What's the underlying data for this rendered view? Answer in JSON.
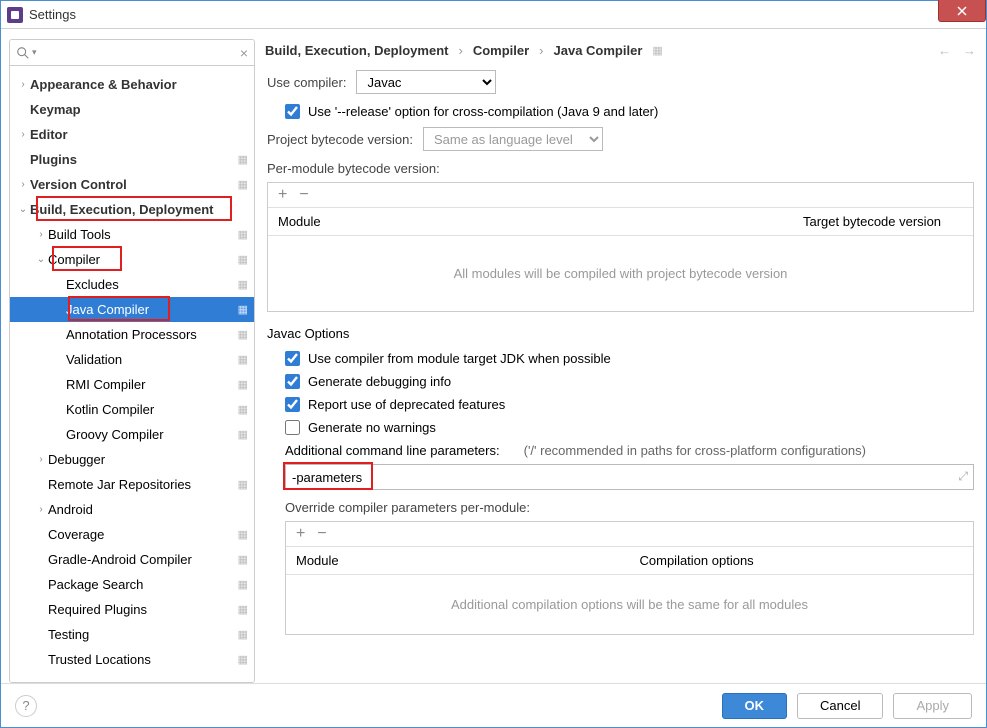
{
  "window": {
    "title": "Settings"
  },
  "search": {
    "placeholder": ""
  },
  "sidebar": {
    "items": [
      {
        "label": "Appearance & Behavior",
        "bold": true,
        "chev": "›",
        "indent": 0,
        "gear": false
      },
      {
        "label": "Keymap",
        "bold": true,
        "chev": "",
        "indent": 0,
        "gear": false
      },
      {
        "label": "Editor",
        "bold": true,
        "chev": "›",
        "indent": 0,
        "gear": false
      },
      {
        "label": "Plugins",
        "bold": true,
        "chev": "",
        "indent": 0,
        "gear": true
      },
      {
        "label": "Version Control",
        "bold": true,
        "chev": "›",
        "indent": 0,
        "gear": true
      },
      {
        "label": "Build, Execution, Deployment",
        "bold": true,
        "chev": "⌄",
        "indent": 0,
        "gear": false,
        "red": true,
        "redLeft": 30,
        "redWidth": 196
      },
      {
        "label": "Build Tools",
        "bold": false,
        "chev": "›",
        "indent": 1,
        "gear": true
      },
      {
        "label": "Compiler",
        "bold": false,
        "chev": "⌄",
        "indent": 1,
        "gear": true,
        "red": true,
        "redLeft": 46,
        "redWidth": 70
      },
      {
        "label": "Excludes",
        "bold": false,
        "chev": "",
        "indent": 2,
        "gear": true
      },
      {
        "label": "Java Compiler",
        "bold": false,
        "chev": "",
        "indent": 2,
        "gear": true,
        "selected": true,
        "red": true,
        "redLeft": 62,
        "redWidth": 102
      },
      {
        "label": "Annotation Processors",
        "bold": false,
        "chev": "",
        "indent": 2,
        "gear": true
      },
      {
        "label": "Validation",
        "bold": false,
        "chev": "",
        "indent": 2,
        "gear": true
      },
      {
        "label": "RMI Compiler",
        "bold": false,
        "chev": "",
        "indent": 2,
        "gear": true
      },
      {
        "label": "Kotlin Compiler",
        "bold": false,
        "chev": "",
        "indent": 2,
        "gear": true
      },
      {
        "label": "Groovy Compiler",
        "bold": false,
        "chev": "",
        "indent": 2,
        "gear": true
      },
      {
        "label": "Debugger",
        "bold": false,
        "chev": "›",
        "indent": 1,
        "gear": false
      },
      {
        "label": "Remote Jar Repositories",
        "bold": false,
        "chev": "",
        "indent": 1,
        "gear": true
      },
      {
        "label": "Android",
        "bold": false,
        "chev": "›",
        "indent": 1,
        "gear": false
      },
      {
        "label": "Coverage",
        "bold": false,
        "chev": "",
        "indent": 1,
        "gear": true
      },
      {
        "label": "Gradle-Android Compiler",
        "bold": false,
        "chev": "",
        "indent": 1,
        "gear": true
      },
      {
        "label": "Package Search",
        "bold": false,
        "chev": "",
        "indent": 1,
        "gear": true
      },
      {
        "label": "Required Plugins",
        "bold": false,
        "chev": "",
        "indent": 1,
        "gear": true
      },
      {
        "label": "Testing",
        "bold": false,
        "chev": "",
        "indent": 1,
        "gear": true
      },
      {
        "label": "Trusted Locations",
        "bold": false,
        "chev": "",
        "indent": 1,
        "gear": true
      }
    ]
  },
  "breadcrumb": {
    "part1": "Build, Execution, Deployment",
    "part2": "Compiler",
    "part3": "Java Compiler",
    "sep": "›"
  },
  "form": {
    "useCompiler_label": "Use compiler:",
    "useCompiler_value": "Javac",
    "releaseOption": "Use '--release' option for cross-compilation (Java 9 and later)",
    "projectBytecode_label": "Project bytecode version:",
    "projectBytecode_placeholder": "Same as language level",
    "perModule_label": "Per-module bytecode version:",
    "table1_col1": "Module",
    "table1_col2": "Target bytecode version",
    "table1_empty": "All modules will be compiled with project bytecode version",
    "javac_title": "Javac Options",
    "opt_moduleJdk": "Use compiler from module target JDK when possible",
    "opt_debug": "Generate debugging info",
    "opt_deprecated": "Report use of deprecated features",
    "opt_nowarn": "Generate no warnings",
    "addlParams_label": "Additional command line parameters:",
    "addlParams_hint": "('/' recommended in paths for cross-platform configurations)",
    "addlParams_value": "-parameters",
    "override_label": "Override compiler parameters per-module:",
    "table2_col1": "Module",
    "table2_col2": "Compilation options",
    "table2_empty": "Additional compilation options will be the same for all modules"
  },
  "footer": {
    "ok": "OK",
    "cancel": "Cancel",
    "apply": "Apply"
  }
}
